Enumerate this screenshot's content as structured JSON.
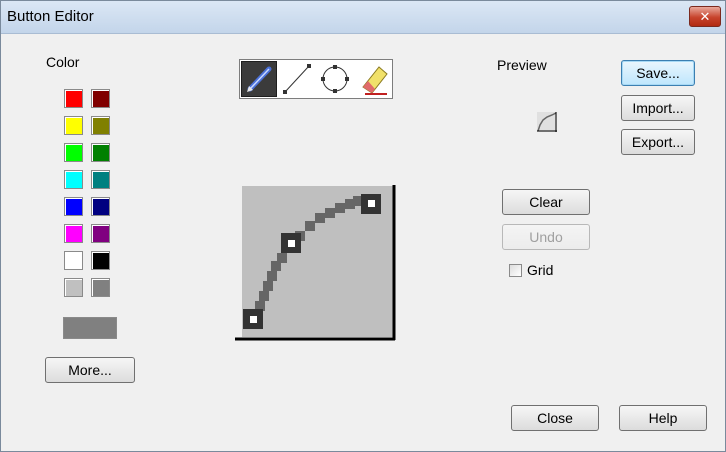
{
  "window": {
    "title": "Button Editor",
    "close_glyph": "✕"
  },
  "color": {
    "label": "Color",
    "palette": [
      [
        "#ff0000",
        "#800000"
      ],
      [
        "#ffff00",
        "#808000"
      ],
      [
        "#00ff00",
        "#008000"
      ],
      [
        "#00ffff",
        "#008080"
      ],
      [
        "#0000ff",
        "#000080"
      ],
      [
        "#ff00ff",
        "#800080"
      ],
      [
        "#ffffff",
        "#000000"
      ],
      [
        "#c0c0c0",
        "#808080"
      ]
    ],
    "current_color": "#808080",
    "more_label": "More..."
  },
  "tools": [
    {
      "name": "pencil-tool",
      "icon": "pencil-icon",
      "active": true
    },
    {
      "name": "line-tool",
      "icon": "line-icon",
      "active": false
    },
    {
      "name": "circle-tool",
      "icon": "circle-icon",
      "active": false
    },
    {
      "name": "eraser-tool",
      "icon": "eraser-icon",
      "active": false
    }
  ],
  "preview": {
    "label": "Preview"
  },
  "buttons": {
    "save": "Save...",
    "import": "Import...",
    "export": "Export...",
    "clear": "Clear",
    "undo": "Undo",
    "close": "Close",
    "help": "Help"
  },
  "grid": {
    "label": "Grid",
    "checked": false
  },
  "colors": {
    "canvas_bg": "#bfbfbf",
    "curve": "#666666",
    "handle": "#333333",
    "axis": "#000000"
  }
}
